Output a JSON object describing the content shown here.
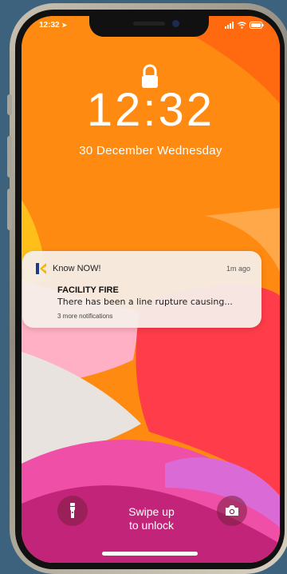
{
  "status_bar": {
    "time": "12:32"
  },
  "lock_screen": {
    "clock": "12:32",
    "date": "30 December Wednesday"
  },
  "notification": {
    "app_icon_letter": "K",
    "app_name": "Know NOW!",
    "time_ago": "1m ago",
    "title": "FACILITY FIRE",
    "body": "There has been a line rupture causing...",
    "more": "3 more notifications"
  },
  "bottom": {
    "swipe_line1": "Swipe up",
    "swipe_line2": "to unlock"
  },
  "colors": {
    "background": "#3c627e",
    "wallpaper_orange": "#ff8a12",
    "wallpaper_red": "#ff3c4a",
    "wallpaper_pink": "#f04fa8",
    "app_icon_yellow": "#f5b400",
    "app_icon_blue": "#1e3a8a"
  },
  "icons": [
    "lock-icon",
    "flashlight-icon",
    "camera-icon",
    "signal-icon",
    "wifi-icon",
    "battery-icon",
    "location-icon"
  ]
}
